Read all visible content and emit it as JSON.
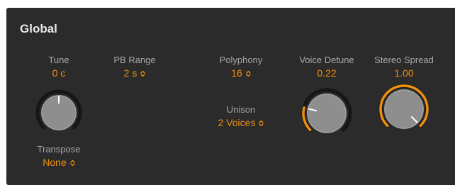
{
  "section": {
    "title": "Global"
  },
  "tune": {
    "label": "Tune",
    "value": "0 c",
    "level": 0.5,
    "icon": "rotary-knob"
  },
  "pb_range": {
    "label": "PB Range",
    "value": "2 s",
    "icon": "chevron-updown-icon"
  },
  "polyphony": {
    "label": "Polyphony",
    "value": "16",
    "icon": "chevron-updown-icon"
  },
  "unison": {
    "label": "Unison",
    "value": "2 Voices",
    "icon": "chevron-updown-icon"
  },
  "voice_detune": {
    "label": "Voice Detune",
    "value": "0.22",
    "level": 0.22,
    "icon": "rotary-knob"
  },
  "stereo_spread": {
    "label": "Stereo Spread",
    "value": "1.00",
    "level": 1.0,
    "icon": "rotary-knob"
  },
  "transpose": {
    "label": "Transpose",
    "value": "None",
    "icon": "chevron-updown-icon"
  },
  "colors": {
    "panel_bg": "#2b2b2b",
    "accent_orange": "#f0900f",
    "label_gray": "#a8a8a8",
    "title_white": "#e6e6e6",
    "knob_body": "#8e8e8e",
    "track": "#161616"
  }
}
